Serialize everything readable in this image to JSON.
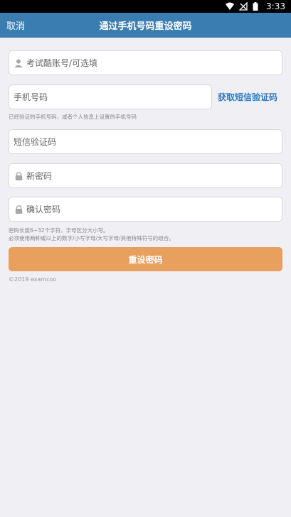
{
  "status_bar": {
    "time": "3:33"
  },
  "header": {
    "cancel_label": "取消",
    "title": "通过手机号码重设密码"
  },
  "form": {
    "account_placeholder": "考试酷账号/可选填",
    "phone_placeholder": "手机号码",
    "sms_link": "获取短信验证码",
    "phone_hint": "已经验证的手机号码，或者个人信息上设置的手机号码",
    "code_placeholder": "短信验证码",
    "new_password_placeholder": "新密码",
    "confirm_password_placeholder": "确认密码",
    "password_rules_line1": "密码长度6~32个字符，字母区分大小写。",
    "password_rules_line2": "必须使用两种或以上的数字/小写字母/大写字母/其他特殊符号的组合。",
    "submit_label": "重设密码"
  },
  "footer": {
    "copyright": "©2019 examcoo"
  },
  "colors": {
    "header_bg": "#3a7db0",
    "submit_bg": "#e8a05f",
    "link": "#2f7dc2",
    "page_bg": "#efeff4"
  }
}
